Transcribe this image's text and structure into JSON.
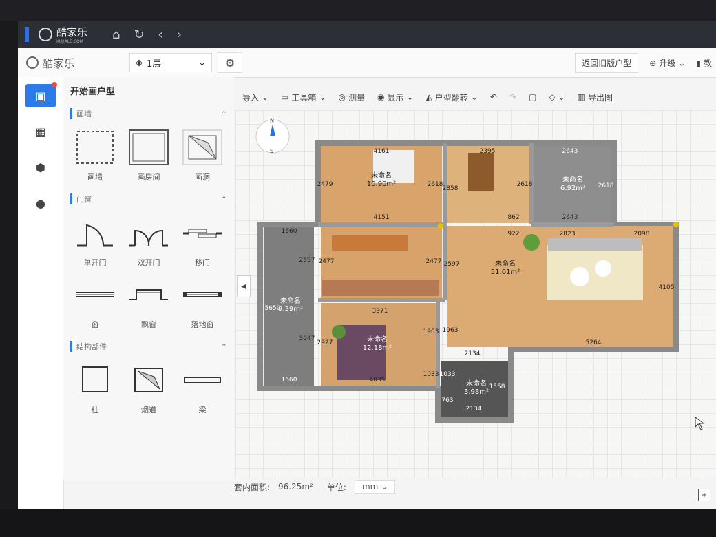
{
  "topbar": {
    "logo_text": "酷家乐",
    "logo_sub": "KUJIALE.COM"
  },
  "header": {
    "logo_text": "酷家乐",
    "floor": "1层",
    "return_old": "返回旧版户型",
    "upgrade": "升级",
    "tutorial": "教"
  },
  "panel": {
    "title": "开始画户型",
    "sec_wall": "画墙",
    "tools_wall": [
      "画墙",
      "画房间",
      "画洞"
    ],
    "sec_door": "门窗",
    "tools_door1": [
      "单开门",
      "双开门",
      "移门"
    ],
    "tools_door2": [
      "窗",
      "飘窗",
      "落地窗"
    ],
    "sec_struct": "结构部件",
    "tools_struct": [
      "柱",
      "烟道",
      "梁"
    ]
  },
  "toolbar": {
    "import": "导入",
    "toolbox": "工具箱",
    "measure": "测量",
    "display": "显示",
    "flip": "户型翻转",
    "export": "导出图"
  },
  "compass": {
    "n": "N",
    "s": "S"
  },
  "rooms": {
    "r1": {
      "name": "未命名",
      "area": "10.90m²"
    },
    "r2": {
      "name": "未命名",
      "area": "6.92m²"
    },
    "r3": {
      "name": "未命名",
      "area": "51.01m²"
    },
    "r4": {
      "name": "未命名",
      "area": "12.18m²"
    },
    "r5": {
      "name": "未命名",
      "area": "9.39m²"
    },
    "r6": {
      "name": "未命名",
      "area": "3.98m²"
    }
  },
  "dims": {
    "d1": "4161",
    "d2": "2395",
    "d3": "2643",
    "d4": "2479",
    "d5": "2618",
    "d6": "2858",
    "d7": "2618",
    "d8": "2618",
    "d9": "4151",
    "d10": "862",
    "d11": "2643",
    "d12": "1660",
    "d13": "922",
    "d14": "2823",
    "d15": "2098",
    "d16": "2597",
    "d17": "2477",
    "d18": "2477",
    "d19": "2597",
    "d20": "4105",
    "d21": "5650",
    "d22": "3971",
    "d23": "1903",
    "d24": "1963",
    "d25": "3047",
    "d26": "2927",
    "d27": "5264",
    "d28": "2134",
    "d29": "1033",
    "d30": "1660",
    "d31": "4035",
    "d32": "1033",
    "d33": "1558",
    "d34": "763",
    "d35": "2134"
  },
  "bottom": {
    "area_label": "套内面积:",
    "area_value": "96.25m²",
    "unit_label": "单位:",
    "unit_value": "mm"
  }
}
